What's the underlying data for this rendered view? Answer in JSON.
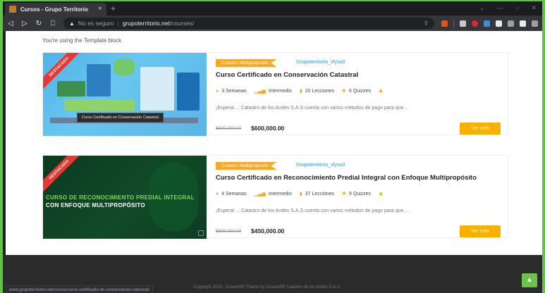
{
  "browser": {
    "tab_title": "Cursos - Grupo Territorio",
    "tab_close": "×",
    "new_tab": "+",
    "security_icon": "warning-triangle-icon",
    "security_label": "No es seguro",
    "url_domain": "grupoterritorio.net",
    "url_path": "/courses/",
    "status_url": "www.grupoterritorio.net/cursos/curso-certificado-en-conservacion-catastral/"
  },
  "page": {
    "template_note": "You're using the Template block",
    "copyright": "Copyright 2023 - OceanWP Theme by OceanWP Catastro de los Andes S.A.S"
  },
  "courses": [
    {
      "badge": "DESTACADO",
      "category": "Catastro Multipropósito",
      "author": "Grupoterritorio_xfysu0",
      "title": "Curso Certificado en Conservación Catastral",
      "duration": "3 Semanas",
      "level": "Intermedio",
      "lessons": "20 Lecciones",
      "quizzes": "6 Quizzes",
      "excerpt": "¡Esperal ... Catastro de los Andes S.A.S cuenta con varios métodos de pago para que…",
      "price_old": "$900,000.00",
      "price_new": "$600,000.00",
      "button": "Ver más",
      "tooltip": "Curso Certificado en Conservación Catastral"
    },
    {
      "badge": "DESTACADO",
      "category": "Catastro Multipropósito",
      "author": "Grupoterritorio_xfysu0",
      "title": "Curso Certificado en Reconocimiento Predial Integral con Enfoque Multipropósito",
      "duration": "4 Semanas",
      "level": "Intermedio",
      "lessons": "37 Lecciones",
      "quizzes": "9 Quizzes",
      "excerpt": "¡Esperal ... Catastro de los Andes S.A.S cuenta con varios métodos de pago para que…",
      "price_old": "$600,000.00",
      "price_new": "$450,000.00",
      "button": "Ver más",
      "promo_line1": "CURSO DE RECONOCIMIENTO PREDIAL INTEGRAL",
      "promo_line2": "CON ENFOQUE MULTIPROPÓSITO"
    }
  ],
  "colors": {
    "accent": "#f9a825",
    "button": "#f9b000",
    "link": "#3a8dde",
    "frame": "#5fc43f"
  }
}
